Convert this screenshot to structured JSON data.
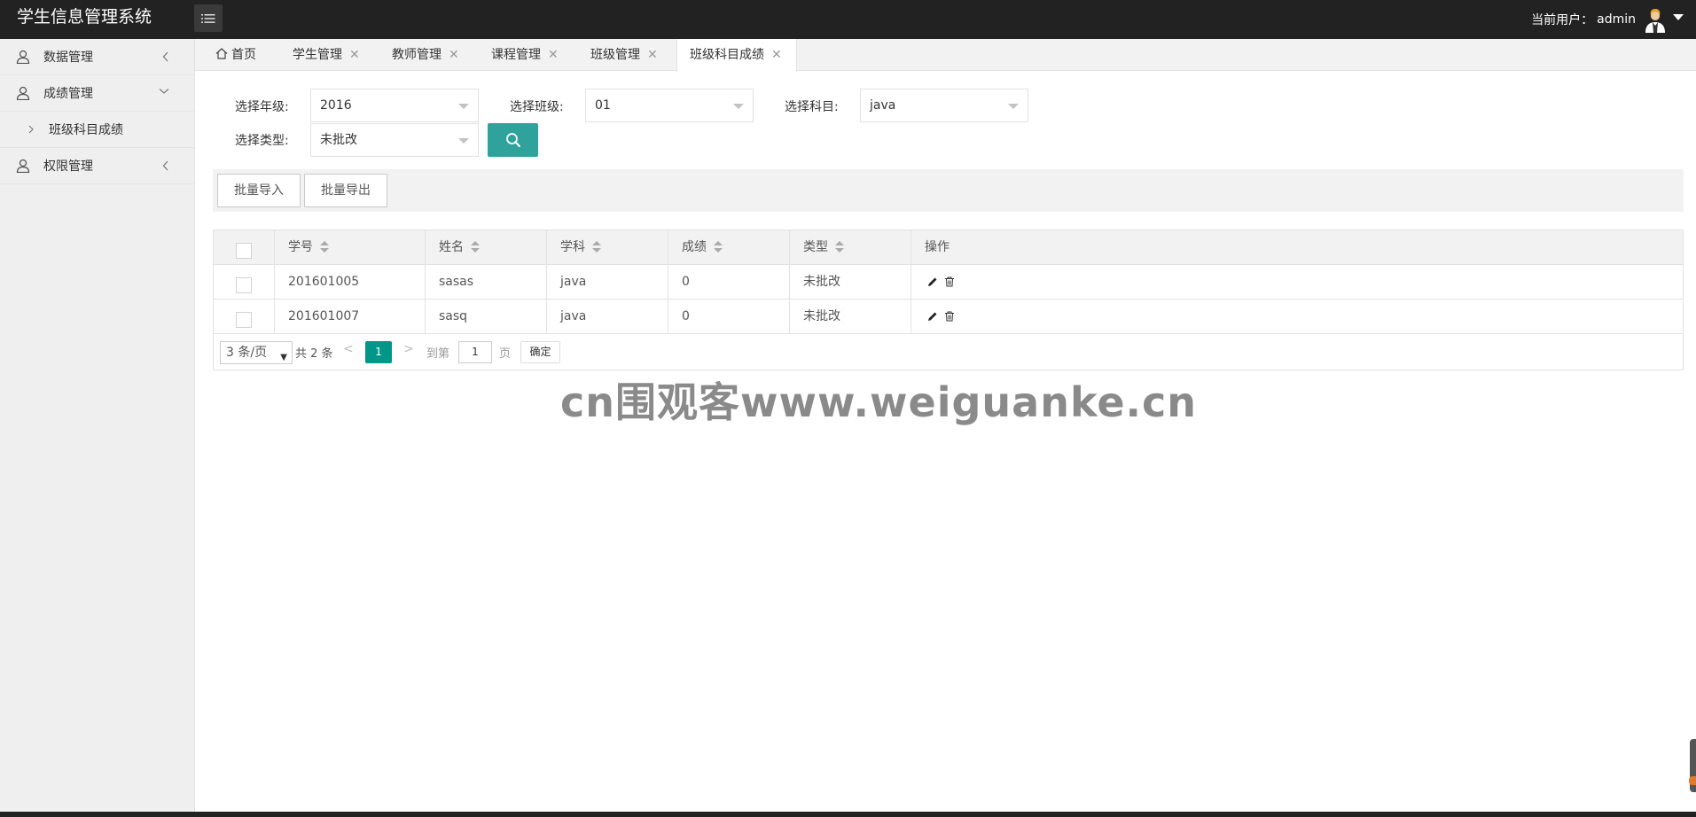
{
  "header": {
    "app_title": "学生信息管理系统",
    "user_label": "当前用户：",
    "user_name": "admin"
  },
  "sidebar": {
    "items": [
      {
        "label": "数据管理",
        "icon": "user-icon",
        "state": "collapsed"
      },
      {
        "label": "成绩管理",
        "icon": "user-icon",
        "state": "expanded",
        "children": [
          {
            "label": "班级科目成绩"
          }
        ]
      },
      {
        "label": "权限管理",
        "icon": "user-icon",
        "state": "collapsed"
      }
    ]
  },
  "tabs": [
    {
      "label": "首页",
      "icon": "home-icon",
      "closable": false
    },
    {
      "label": "学生管理",
      "closable": true
    },
    {
      "label": "教师管理",
      "closable": true
    },
    {
      "label": "课程管理",
      "closable": true
    },
    {
      "label": "班级管理",
      "closable": true
    },
    {
      "label": "班级科目成绩",
      "closable": true,
      "active": true
    }
  ],
  "filters": {
    "grade_label": "选择年级:",
    "grade_value": "2016",
    "class_label": "选择班级:",
    "class_value": "01",
    "subject_label": "选择科目:",
    "subject_value": "java",
    "type_label": "选择类型:",
    "type_value": "未批改"
  },
  "toolbar": {
    "import_label": "批量导入",
    "export_label": "批量导出"
  },
  "table": {
    "columns": [
      "学号",
      "姓名",
      "学科",
      "成绩",
      "类型",
      "操作"
    ],
    "rows": [
      {
        "id": "201601005",
        "name": "sasas",
        "subject": "java",
        "score": "0",
        "type": "未批改"
      },
      {
        "id": "201601007",
        "name": "sasq",
        "subject": "java",
        "score": "0",
        "type": "未批改"
      }
    ]
  },
  "pagination": {
    "per_page": "3 条/页",
    "total": "共 2 条",
    "current_page": "1",
    "goto_label": "到第",
    "goto_value": "1",
    "page_unit": "页",
    "confirm_label": "确定"
  },
  "watermark": "cn围观客www.weiguanke.cn",
  "colors": {
    "header_bg": "#222222",
    "accent": "#009688",
    "search_btn": "#2fa39b"
  }
}
